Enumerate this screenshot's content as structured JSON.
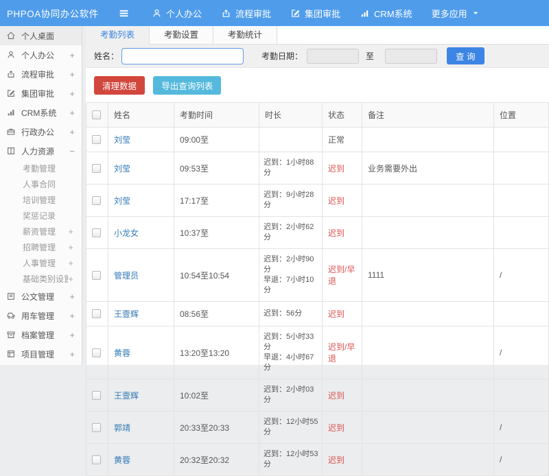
{
  "topbar": {
    "logo": "PHPOA协同办公软件",
    "nav": [
      {
        "label": "个人办公",
        "icon": "user-icon"
      },
      {
        "label": "流程审批",
        "icon": "flow-icon"
      },
      {
        "label": "集团审批",
        "icon": "edit-icon"
      },
      {
        "label": "CRM系统",
        "icon": "chart-icon"
      },
      {
        "label": "更多应用",
        "icon": "",
        "caret": true
      }
    ]
  },
  "sidebar": {
    "items": [
      {
        "label": "个人桌面",
        "icon": "home-icon",
        "active": true,
        "expander": ""
      },
      {
        "label": "个人办公",
        "icon": "user-icon",
        "expander": "+"
      },
      {
        "label": "流程审批",
        "icon": "flow-icon",
        "expander": "+"
      },
      {
        "label": "集团审批",
        "icon": "edit-icon",
        "expander": "+"
      },
      {
        "label": "CRM系统",
        "icon": "chart-icon",
        "expander": "+"
      },
      {
        "label": "行政办公",
        "icon": "briefcase-icon",
        "expander": "+"
      },
      {
        "label": "人力资源",
        "icon": "book-icon",
        "expander": "−",
        "children": [
          {
            "label": "考勤管理",
            "expander": ""
          },
          {
            "label": "人事合同",
            "expander": ""
          },
          {
            "label": "培训管理",
            "expander": ""
          },
          {
            "label": "奖惩记录",
            "expander": ""
          },
          {
            "label": "薪资管理",
            "expander": "+"
          },
          {
            "label": "招聘管理",
            "expander": "+"
          },
          {
            "label": "人事管理",
            "expander": "+"
          },
          {
            "label": "基础类别设置",
            "expander": "+"
          }
        ]
      },
      {
        "label": "公文管理",
        "icon": "doc-icon",
        "expander": "+"
      },
      {
        "label": "用车管理",
        "icon": "car-icon",
        "expander": "+"
      },
      {
        "label": "档案管理",
        "icon": "archive-icon",
        "expander": "+"
      },
      {
        "label": "项目管理",
        "icon": "project-icon",
        "expander": "+"
      }
    ]
  },
  "tabs": [
    {
      "label": "考勤列表",
      "active": true
    },
    {
      "label": "考勤设置",
      "active": false
    },
    {
      "label": "考勤统计",
      "active": false
    }
  ],
  "filter": {
    "name_label": "姓名：",
    "name_value": "",
    "date_label": "考勤日期：",
    "date_from": "",
    "to_label": "至",
    "date_to": "",
    "search_button": "查 询"
  },
  "actions": {
    "clear_button": "清理数据",
    "export_button": "导出查询列表"
  },
  "table": {
    "columns": [
      "姓名",
      "考勤时间",
      "时长",
      "状态",
      "备注",
      "位置"
    ],
    "rows": [
      {
        "name": "刘莹",
        "time": "09:00至",
        "duration": [],
        "status": "正常",
        "status_type": "normal",
        "remark": "",
        "location": ""
      },
      {
        "name": "刘莹",
        "time": "09:53至",
        "duration": [
          "迟到：1小时88分"
        ],
        "status": "迟到",
        "status_type": "late",
        "remark": "业务需要外出",
        "location": ""
      },
      {
        "name": "刘莹",
        "time": "17:17至",
        "duration": [
          "迟到：9小时28分"
        ],
        "status": "迟到",
        "status_type": "late",
        "remark": "",
        "location": ""
      },
      {
        "name": "小龙女",
        "time": "10:37至",
        "duration": [
          "迟到：2小时62分"
        ],
        "status": "迟到",
        "status_type": "late",
        "remark": "",
        "location": ""
      },
      {
        "name": "管理员",
        "time": "10:54至10:54",
        "duration": [
          "迟到：2小时90分",
          "早退：7小时10分"
        ],
        "status": "迟到/早退",
        "status_type": "late",
        "remark": "1111",
        "location": "/"
      },
      {
        "name": "王壹辉",
        "time": "08:56至",
        "duration": [
          "迟到：56分"
        ],
        "status": "迟到",
        "status_type": "late",
        "remark": "",
        "location": ""
      },
      {
        "name": "黄蓉",
        "time": "13:20至13:20",
        "duration": [
          "迟到：5小时33分",
          "早退：4小时67分"
        ],
        "status": "迟到/早退",
        "status_type": "late",
        "remark": "",
        "location": "/"
      },
      {
        "name": "王壹辉",
        "time": "10:02至",
        "duration": [
          "迟到：2小时03分"
        ],
        "status": "迟到",
        "status_type": "late",
        "remark": "",
        "location": ""
      },
      {
        "name": "郭靖",
        "time": "20:33至20:33",
        "duration": [
          "迟到：12小时55分"
        ],
        "status": "迟到",
        "status_type": "late",
        "remark": "",
        "location": "/"
      },
      {
        "name": "黄蓉",
        "time": "20:32至20:32",
        "duration": [
          "迟到：12小时53分"
        ],
        "status": "迟到",
        "status_type": "late",
        "remark": "",
        "location": "/"
      }
    ]
  },
  "colors": {
    "topbar_blue": "#4f9ceb",
    "primary_blue": "#3d85e4",
    "danger_red": "#d2473d",
    "info_teal": "#54b9dd",
    "link_blue": "#337ab7",
    "late_red": "#d9534f"
  }
}
